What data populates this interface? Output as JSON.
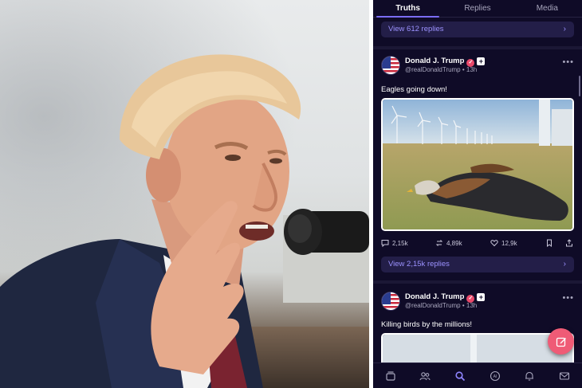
{
  "tabs": [
    {
      "label": "Truths",
      "active": true
    },
    {
      "label": "Replies",
      "active": false
    },
    {
      "label": "Media",
      "active": false
    }
  ],
  "top_replies": {
    "label": "View 612 replies"
  },
  "posts": [
    {
      "author": "Donald J. Trump",
      "handle": "@realDonaldTrump • 13h",
      "text": "Eagles going down!",
      "comments": "2,15k",
      "retruths": "4,89k",
      "likes": "12,9k",
      "replies_label": "View 2,15k replies"
    },
    {
      "author": "Donald J. Trump",
      "handle": "@realDonaldTrump • 13h",
      "text": "Killing birds by the millions!"
    }
  ],
  "icons": {
    "verified": "verified-badge-icon",
    "plus": "plus-badge-icon",
    "more": "more-options-icon",
    "comment": "comment-icon",
    "retruth": "retruth-icon",
    "like": "heart-icon",
    "bookmark": "bookmark-icon",
    "share": "share-icon",
    "compose": "compose-icon"
  },
  "bottom_nav": [
    "home-icon",
    "groups-icon",
    "search-icon",
    "ai-icon",
    "bell-icon",
    "messages-icon"
  ],
  "colors": {
    "background": "#0f0b27",
    "accent": "#7b6cf6",
    "reply_bar": "#231e48",
    "fab": "#ef5b76"
  }
}
